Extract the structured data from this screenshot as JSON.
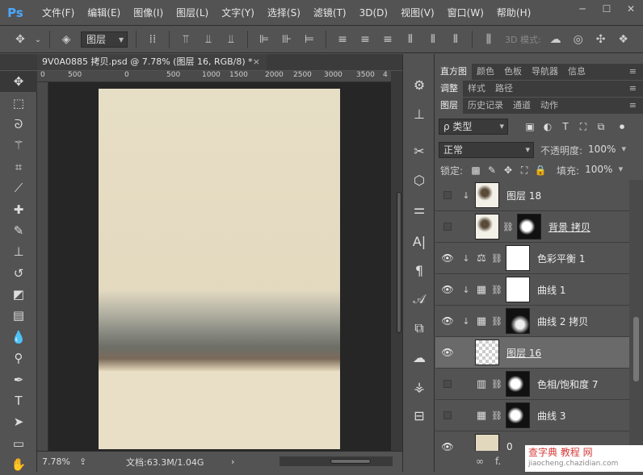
{
  "app": {
    "logo": "Ps"
  },
  "menu": [
    "文件(F)",
    "编辑(E)",
    "图像(I)",
    "图层(L)",
    "文字(Y)",
    "选择(S)",
    "滤镜(T)",
    "3D(D)",
    "视图(V)",
    "窗口(W)",
    "帮助(H)"
  ],
  "window_controls": {
    "minimize": "─",
    "restore": "☐",
    "close": "✕"
  },
  "options": {
    "auto_select_target": "图层",
    "mode_label": "3D 模式:"
  },
  "document": {
    "tab_title": "9V0A0885 拷贝.psd @ 7.78% (图层 16, RGB/8) *",
    "close": "×",
    "ruler_ticks": [
      "0",
      "500",
      "0",
      "500",
      "1000",
      "1500",
      "2000",
      "2500",
      "3000",
      "3500",
      "4"
    ]
  },
  "status": {
    "zoom": "7.78%",
    "doc_size": "文档:63.3M/1.04G",
    "arrow": "›",
    "left_arrow": "‹",
    "right_arrow": "›"
  },
  "panels": {
    "row1_tabs": [
      "直方图",
      "颜色",
      "色板",
      "导航器",
      "信息"
    ],
    "row2_tabs": [
      "调整",
      "样式",
      "路径"
    ],
    "row3_tabs": [
      "图层",
      "历史记录",
      "通道",
      "动作"
    ],
    "menu_icon": "≡",
    "filter_kind": "ρ 类型",
    "blend_mode": "正常",
    "opacity_label": "不透明度:",
    "opacity_value": "100%",
    "lock_label": "锁定:",
    "fill_label": "填充:",
    "fill_value": "100%",
    "footer_link": "∞",
    "footer_fx": "f."
  },
  "layers": [
    {
      "name": "图层 18",
      "visible": false,
      "clipped": true,
      "thumb": "tree",
      "mask": null,
      "adj": null
    },
    {
      "name": "背景 拷贝",
      "visible": false,
      "clipped": false,
      "thumb": "tree",
      "mask": "mask",
      "adj": null,
      "underline": true
    },
    {
      "name": "色彩平衡 1",
      "visible": true,
      "clipped": true,
      "thumb": "white",
      "mask": null,
      "adj": "⚖"
    },
    {
      "name": "曲线 1",
      "visible": true,
      "clipped": true,
      "thumb": "white",
      "mask": null,
      "adj": "▦"
    },
    {
      "name": "曲线 2 拷贝",
      "visible": true,
      "clipped": true,
      "thumb": "dark",
      "mask": null,
      "adj": "▦"
    },
    {
      "name": "图层 16",
      "visible": true,
      "clipped": false,
      "thumb": "checker",
      "mask": null,
      "adj": null,
      "selected": true,
      "underline": true
    },
    {
      "name": "色相/饱和度 7",
      "visible": false,
      "clipped": false,
      "thumb": "mask",
      "mask": null,
      "adj": "▥"
    },
    {
      "name": "曲线 3",
      "visible": false,
      "clipped": false,
      "thumb": "mask",
      "mask": null,
      "adj": "▦"
    },
    {
      "name": "0",
      "visible": true,
      "clipped": false,
      "thumb": "paper",
      "mask": null,
      "adj": null
    }
  ],
  "watermark": {
    "text": "查字典 教程 网",
    "sub": "jiaocheng.chazidian.com"
  }
}
